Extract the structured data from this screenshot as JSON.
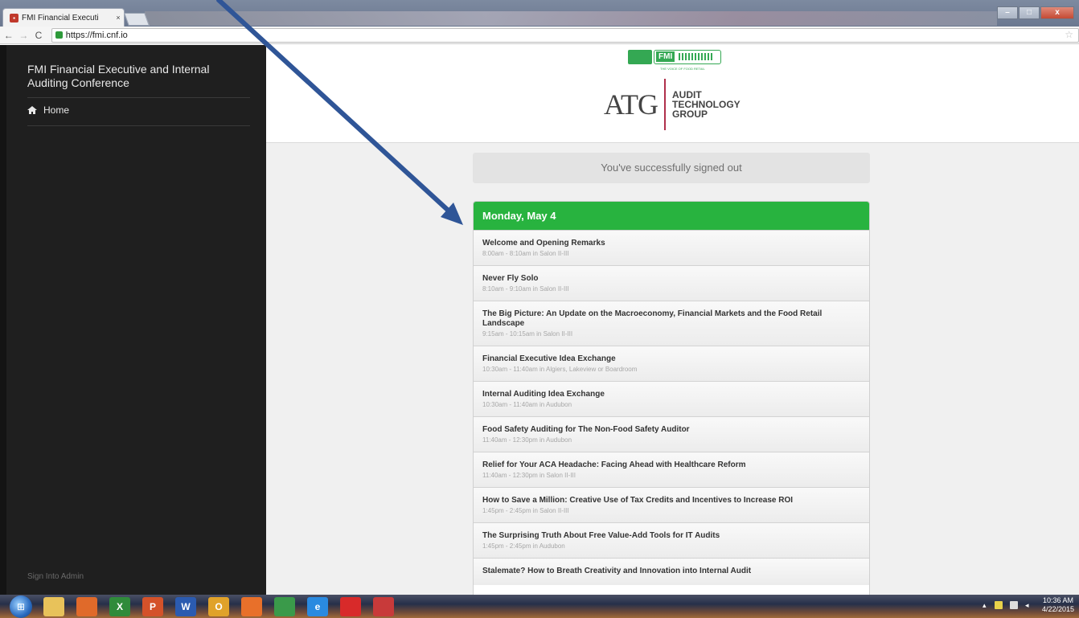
{
  "browser": {
    "tab_title": "FMI Financial Executi",
    "tab_close": "×",
    "url": "https://fmi.cnf.io",
    "back": "←",
    "forward": "→",
    "reload": "C",
    "bookmark_star": "☆",
    "window_controls": {
      "minimize": "–",
      "maximize": "□",
      "close": "x"
    }
  },
  "sidebar": {
    "brand": "FMI Financial Executive and Internal Auditing Conference",
    "nav": [
      {
        "label": "Home",
        "icon": "home-icon"
      }
    ],
    "footer_link": "Sign Into Admin"
  },
  "header": {
    "fmi_badge": "FMI",
    "fmi_tagline": "THE VOICE OF FOOD RETAIL",
    "atg_mark": "ATG",
    "atg_line1": "AUDIT",
    "atg_line2": "TECHNOLOGY",
    "atg_line3": "GROUP"
  },
  "notice": "You've successfully signed out",
  "schedule": {
    "day": "Monday, May 4",
    "sessions": [
      {
        "title": "Welcome and Opening Remarks",
        "meta": "8:00am - 8:10am in Salon II-III"
      },
      {
        "title": "Never Fly Solo",
        "meta": "8:10am - 9:10am in Salon II-III"
      },
      {
        "title": "The Big Picture: An Update on the Macroeconomy, Financial Markets and the Food Retail Landscape",
        "meta": "9:15am - 10:15am in Salon II-III"
      },
      {
        "title": "Financial Executive Idea Exchange",
        "meta": "10:30am - 11:40am in Algiers, Lakeview or Boardroom"
      },
      {
        "title": "Internal Auditing Idea Exchange",
        "meta": "10:30am - 11:40am in Audubon"
      },
      {
        "title": "Food Safety Auditing for The Non-Food Safety Auditor",
        "meta": "11:40am - 12:30pm in Audubon"
      },
      {
        "title": "Relief for Your ACA Headache: Facing Ahead with Healthcare Reform",
        "meta": "11:40am - 12:30pm in Salon II-III"
      },
      {
        "title": "How to Save a Million: Creative Use of Tax Credits and Incentives to Increase ROI",
        "meta": "1:45pm - 2:45pm in Salon II-III"
      },
      {
        "title": "The Surprising Truth About Free Value-Add Tools for IT Audits",
        "meta": "1:45pm - 2:45pm in Audubon"
      },
      {
        "title": "Stalemate? How to Breath Creativity and Innovation into Internal Audit",
        "meta": ""
      }
    ]
  },
  "taskbar": {
    "apps": [
      {
        "name": "explorer-icon",
        "glyph": "",
        "color": "#e8c25a"
      },
      {
        "name": "media-player-icon",
        "glyph": "",
        "color": "#e06a2a"
      },
      {
        "name": "excel-icon",
        "glyph": "X",
        "color": "#2f8b3a"
      },
      {
        "name": "powerpoint-icon",
        "glyph": "P",
        "color": "#d4522a"
      },
      {
        "name": "word-icon",
        "glyph": "W",
        "color": "#2b5bb0"
      },
      {
        "name": "outlook-icon",
        "glyph": "O",
        "color": "#e0a22a"
      },
      {
        "name": "firefox-icon",
        "glyph": "",
        "color": "#e8702a"
      },
      {
        "name": "chrome-icon",
        "glyph": "",
        "color": "#3a9a4a"
      },
      {
        "name": "ie-icon",
        "glyph": "e",
        "color": "#2a8ae0"
      },
      {
        "name": "acrobat-icon",
        "glyph": "",
        "color": "#d82a2a"
      },
      {
        "name": "snipping-icon",
        "glyph": "",
        "color": "#c83a3a"
      }
    ],
    "time": "10:36 AM",
    "date": "4/22/2015"
  }
}
